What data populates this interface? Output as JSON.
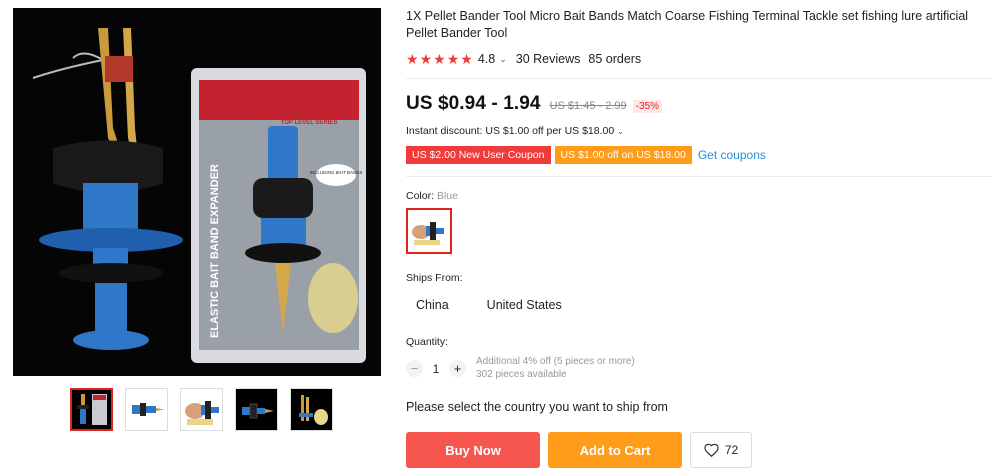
{
  "product": {
    "title": "1X Pellet Bander Tool Micro Bait Bands Match Coarse Fishing Terminal Tackle set fishing lure artificial Pellet Bander Tool",
    "rating": "4.8",
    "reviews": "30 Reviews",
    "orders": "85 orders",
    "star_count": 5
  },
  "package_text": {
    "brand_strip": "TOP LEVEL SERIES",
    "side_label": "ELASTIC BAIT BAND EXPANDER",
    "sticker": "INCLUDING BAIT BANDS"
  },
  "price": {
    "range": "US $0.94 - 1.94",
    "original": "US $1.45 - 2.99",
    "discount": "-35%"
  },
  "instant_discount": "Instant discount: US $1.00 off per US $18.00",
  "coupons": [
    {
      "label": "US $2.00 New User Coupon"
    },
    {
      "label": "US $1.00 off on US $18.00"
    }
  ],
  "get_coupons": "Get coupons",
  "color": {
    "label": "Color:",
    "selected": "Blue"
  },
  "ships_from": {
    "label": "Ships From:",
    "options": [
      "China",
      "United States"
    ]
  },
  "quantity": {
    "label": "Quantity:",
    "value": "1",
    "note_line1": "Additional 4% off (5 pieces or more)",
    "note_line2": "302 pieces available"
  },
  "select_country": "Please select the country you want to ship from",
  "buttons": {
    "buy_now": "Buy Now",
    "add_to_cart": "Add to Cart",
    "wishlist_count": "72"
  },
  "colors": {
    "accent_red": "#f6564e",
    "accent_orange": "#ff9d1b",
    "star": "#f23a3a",
    "link_blue": "#2b8fd6"
  }
}
